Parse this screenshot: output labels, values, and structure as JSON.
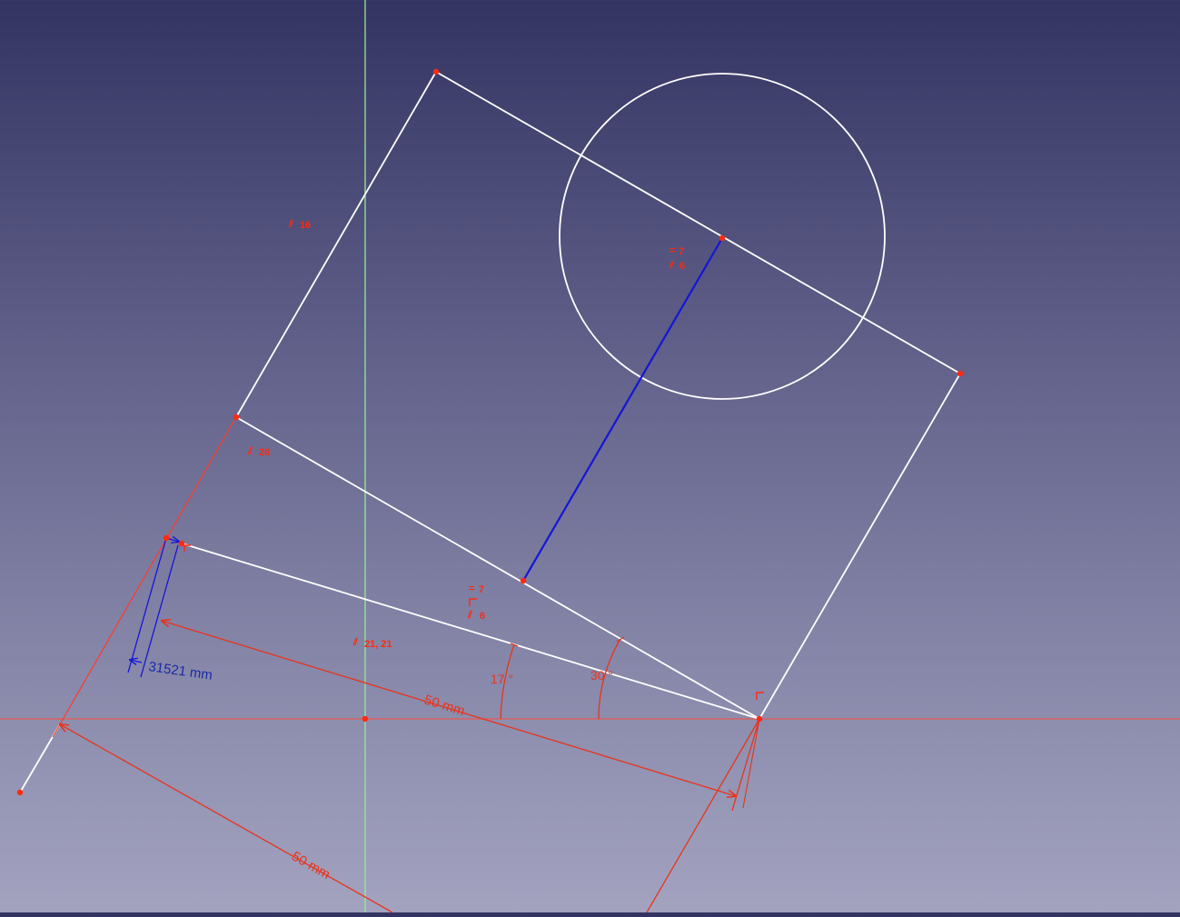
{
  "colors": {
    "background_top": "#343463",
    "background_bottom": "#a3a3c0",
    "geometry": "#ffffff",
    "constraint": "#e8341c",
    "selected": "#1515d8",
    "axis_vertical": "#90ee90",
    "axis_horizontal": "#ff4a3a",
    "point": "#ff2a10"
  },
  "dimensions": {
    "distance_upper": "50 mm",
    "distance_lower": "50 mm",
    "angle_inner": "17 °",
    "angle_outer": "30 °",
    "selected_distance": "31521 mm"
  },
  "constraints": {
    "c1": "16",
    "c2": "26",
    "c3_equal": "7",
    "c3_parallel": "6",
    "c4_equal": "7",
    "c4_parallel": "6",
    "c5": "21, 21"
  }
}
